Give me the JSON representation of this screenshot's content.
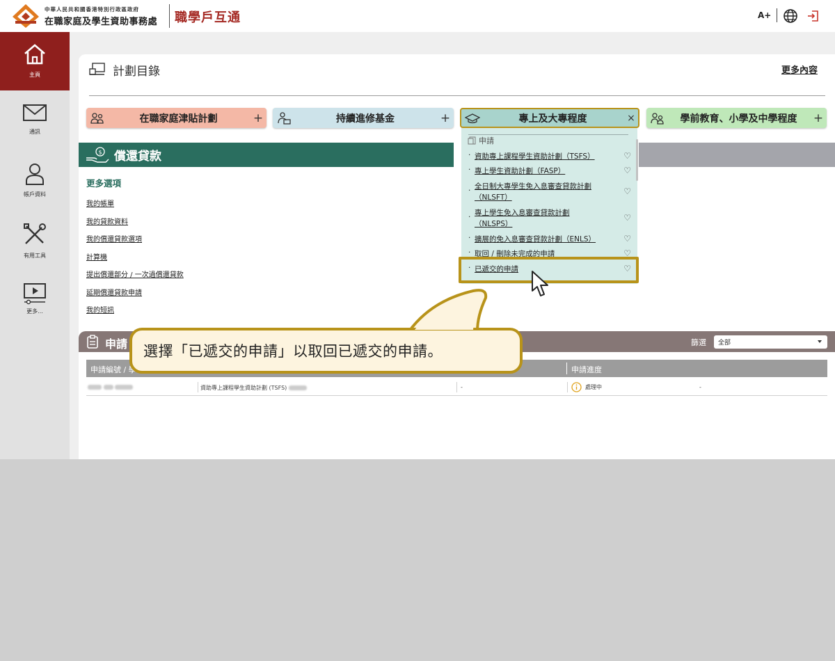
{
  "header": {
    "org_small": "中華人民共和國香港特別行政區政府",
    "org_name": "在職家庭及學生資助事務處",
    "brand": "職學戶互通",
    "font_size_btn": "A+",
    "icons": [
      "globe-icon",
      "logout-icon"
    ],
    "accent_color": "#a52a24"
  },
  "sidebar": {
    "items": [
      {
        "label": "主頁",
        "icon": "home-icon",
        "active": true
      },
      {
        "label": "通訊",
        "icon": "mail-icon",
        "active": false
      },
      {
        "label": "帳戶資料",
        "icon": "user-icon",
        "active": false
      },
      {
        "label": "有用工具",
        "icon": "tools-icon",
        "active": false
      },
      {
        "label": "更多...",
        "icon": "video-icon",
        "active": false
      }
    ]
  },
  "catalogue": {
    "title": "計劃目錄",
    "more": "更多內容",
    "tabs": [
      {
        "label": "在職家庭津貼計劃",
        "action": "+",
        "color": "#f4b8a6"
      },
      {
        "label": "持續進修基金",
        "action": "+",
        "color": "#cde3ea"
      },
      {
        "label": "專上及大專程度",
        "action": "×",
        "color": "#a8d3cc"
      },
      {
        "label": "學前教育、小學及中學程度",
        "action": "+",
        "color": "#bfe8b9"
      }
    ]
  },
  "dropdown": {
    "section": "申請",
    "items": [
      {
        "label": "資助專上課程學生資助計劃（TSFS）",
        "heart": "♡"
      },
      {
        "label": "專上學生資助計劃（FASP）",
        "heart": "♡"
      },
      {
        "label": "全日制大專學生免入息審查貸款計劃（NLSFT）",
        "heart": "♡"
      },
      {
        "label": "專上學生免入息審查貸款計劃（NLSPS）",
        "heart": "♡"
      },
      {
        "label": "擴展的免入息審查貸款計劃（ENLS）",
        "heart": "♡"
      },
      {
        "label": "取回 / 刪除未完成的申請",
        "heart": "♡"
      },
      {
        "label": "已遞交的申請",
        "heart": "♡"
      }
    ]
  },
  "repay": {
    "title": "償還貸款",
    "more_options": "更多選項",
    "links": [
      "我的帳單",
      "我的貸款資料",
      "我的償還貸款選項",
      "計算機",
      "提出償還部分 / 一次過償還貸款",
      "延期償還貸款申請",
      "我的短訊"
    ],
    "color": "#2a6e5f"
  },
  "applications": {
    "title": "申請",
    "filter_label": "篩選",
    "filter_value": "全部",
    "columns": [
      "申請編號 / 學",
      "",
      "",
      "申請進度"
    ],
    "rows": [
      {
        "scheme": "資助專上課程學生資助計劃 (TSFS)",
        "col3": "-",
        "status": "處理中",
        "col5": "-"
      }
    ]
  },
  "callout": {
    "text": "選擇「已遞交的申請」以取回已遞交的申請。"
  }
}
